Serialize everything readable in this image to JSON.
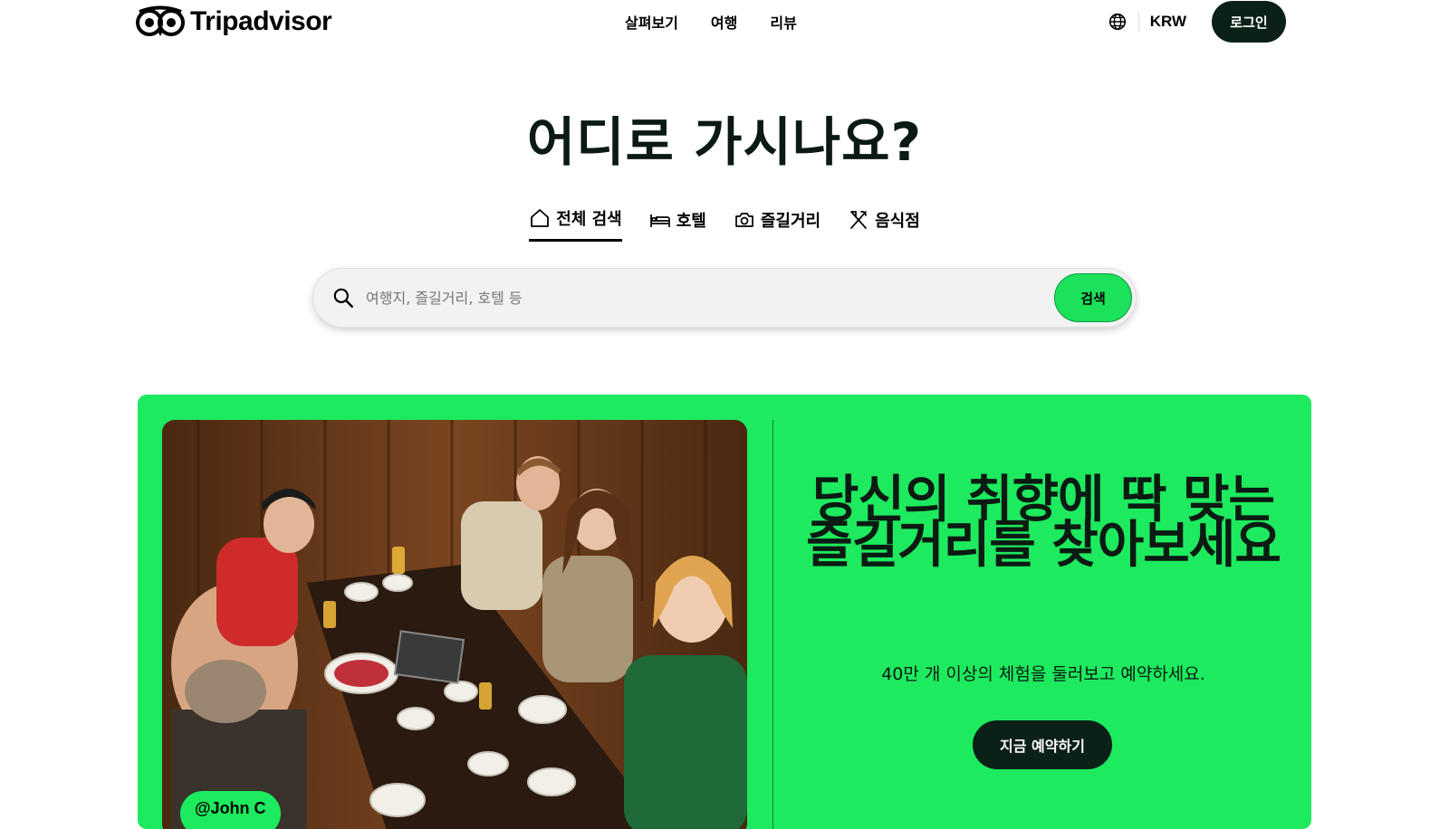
{
  "header": {
    "brand": "Tripadvisor",
    "nav": [
      {
        "label": "살펴보기"
      },
      {
        "label": "여행"
      },
      {
        "label": "리뷰"
      }
    ],
    "currency": "KRW",
    "login_label": "로그인"
  },
  "hero": {
    "title": "어디로 가시나요?",
    "tabs": [
      {
        "label": "전체 검색",
        "icon": "home-icon",
        "active": true
      },
      {
        "label": "호텔",
        "icon": "bed-icon",
        "active": false
      },
      {
        "label": "즐길거리",
        "icon": "camera-icon",
        "active": false
      },
      {
        "label": "음식점",
        "icon": "utensils-icon",
        "active": false
      }
    ],
    "search": {
      "placeholder": "여행지, 즐길거리, 호텔 등",
      "button_label": "검색"
    }
  },
  "promo": {
    "photo_credit": "@John C",
    "title": "당신의 취향에 딱 맞는 즐길거리를 찾아보세요",
    "subtitle": "40만 개 이상의 체험을 둘러보고 예약하세요.",
    "cta_label": "지금 예약하기"
  },
  "colors": {
    "brand_green": "#1dea5e",
    "dark": "#0b2017"
  }
}
